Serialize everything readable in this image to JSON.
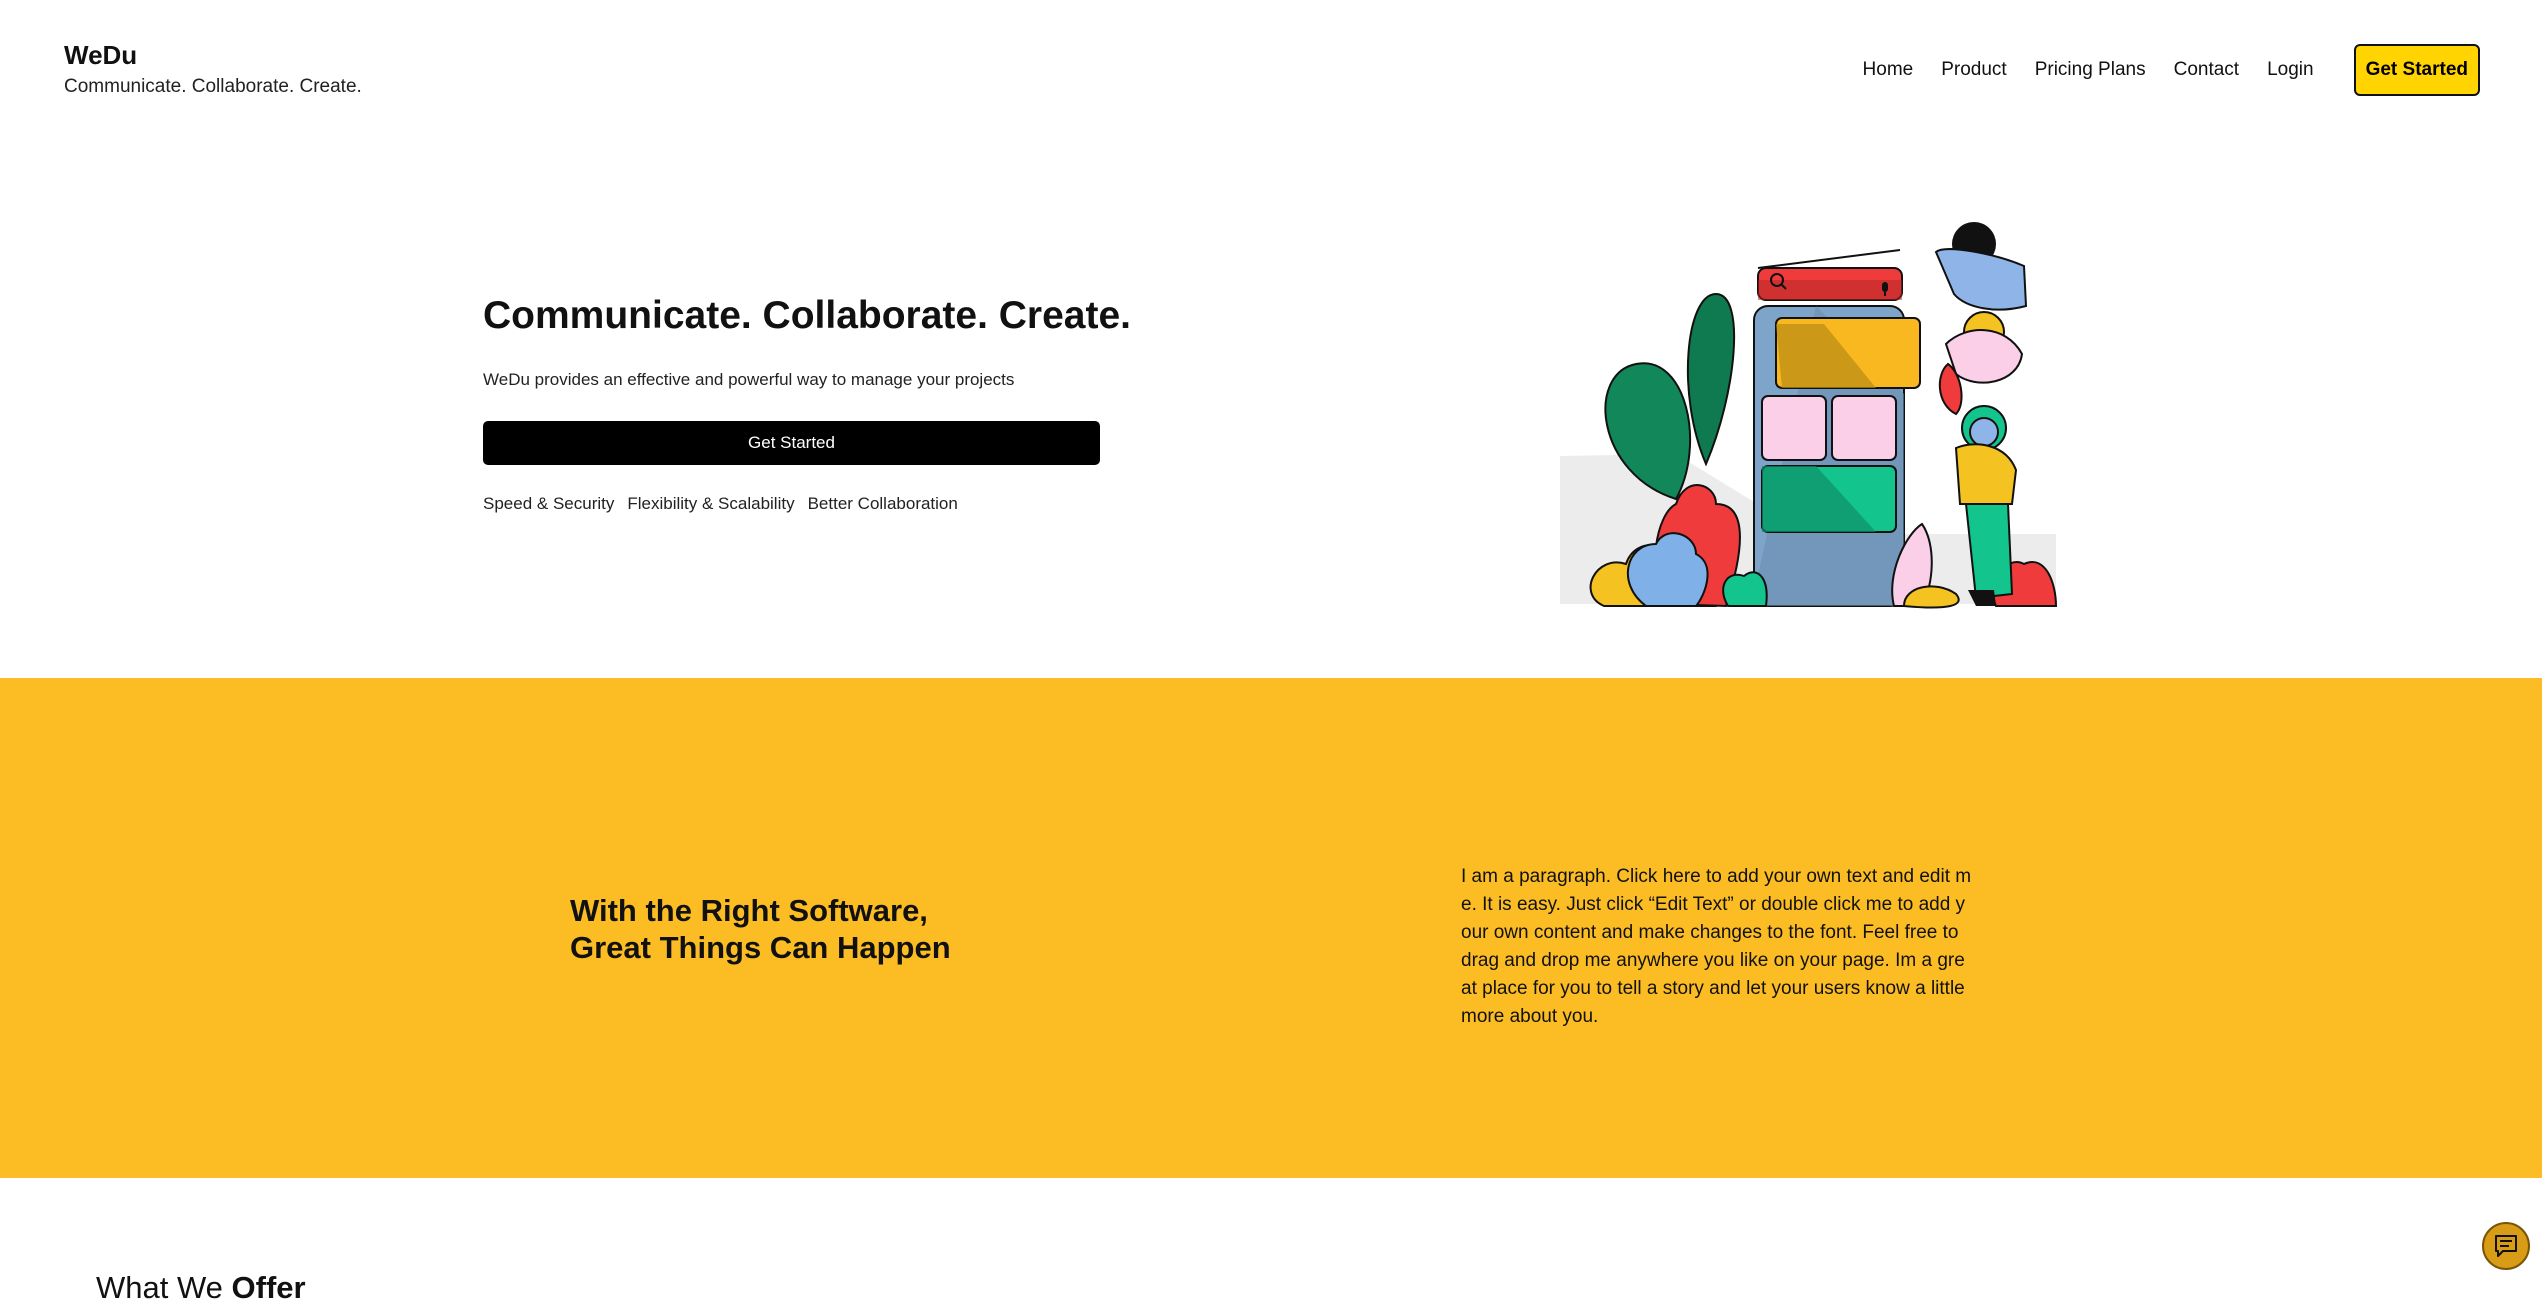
{
  "header": {
    "brand_name": "WeDu",
    "brand_tagline": "Communicate. Collaborate. Create.",
    "nav": [
      "Home",
      "Product",
      "Pricing Plans",
      "Contact",
      "Login"
    ],
    "cta_label": "Get Started"
  },
  "hero": {
    "title": "Communicate. Collaborate. Create.",
    "subtitle": "WeDu provides an effective and powerful way to manage your projects",
    "button_label": "Get Started",
    "features": [
      "Speed & Security",
      "Flexibility & Scalability",
      "Better Collaboration"
    ]
  },
  "band": {
    "title_line1": "With the Right Software,",
    "title_line2": "Great Things Can Happen",
    "paragraph": "I am a paragraph. Click here to add your own text and edit me. It is easy. Just click “Edit Text” or double click me to add your own content and make changes to the font. Feel free to drag and drop me anywhere you like on your page. Im a great place for you to tell a story and let your users know a little more about you."
  },
  "next_section": {
    "heading_prefix": "What We ",
    "heading_bold": "Offer"
  },
  "icons": {
    "chat": "chat-icon",
    "search": "search-icon",
    "mic": "microphone-icon"
  },
  "colors": {
    "band_yellow": "#fcbd24",
    "cta_yellow": "#ffd400",
    "hero_button": "#000000"
  }
}
